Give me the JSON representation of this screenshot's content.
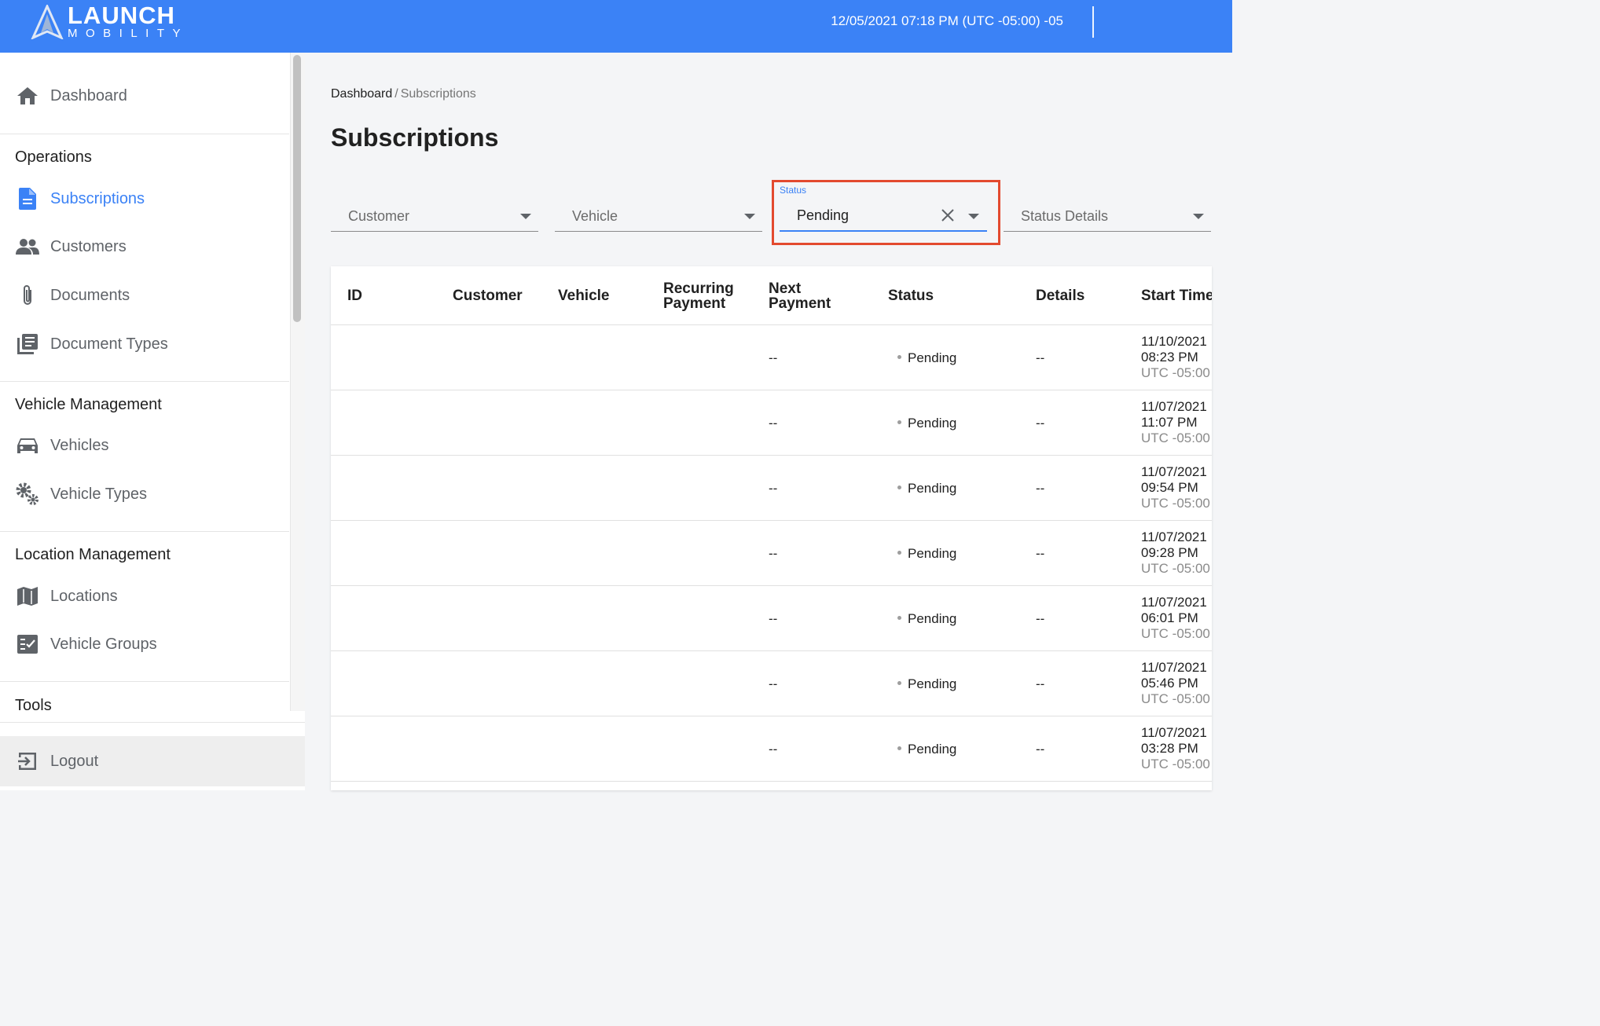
{
  "header": {
    "logo_word": "LAUNCH",
    "logo_sub": "MOBILITY",
    "datetime": "12/05/2021 07:18 PM (UTC -05:00) -05",
    "bg_color": "#3b82f6"
  },
  "sidebar": {
    "dashboard": {
      "label": "Dashboard",
      "icon": "home-icon"
    },
    "sections": {
      "operations": "Operations",
      "vehicle_management": "Vehicle Management",
      "location_management": "Location Management",
      "tools": "Tools"
    },
    "items": {
      "subscriptions": {
        "label": "Subscriptions",
        "icon": "document-icon",
        "active": true
      },
      "customers": {
        "label": "Customers",
        "icon": "people-icon"
      },
      "documents": {
        "label": "Documents",
        "icon": "paperclip-icon"
      },
      "document_types": {
        "label": "Document Types",
        "icon": "library-books-icon"
      },
      "vehicles": {
        "label": "Vehicles",
        "icon": "car-icon"
      },
      "vehicle_types": {
        "label": "Vehicle Types",
        "icon": "gears-icon"
      },
      "locations": {
        "label": "Locations",
        "icon": "map-icon"
      },
      "vehicle_groups": {
        "label": "Vehicle Groups",
        "icon": "checklist-icon"
      }
    },
    "logout": {
      "label": "Logout",
      "icon": "logout-icon"
    }
  },
  "breadcrumb": {
    "root": "Dashboard",
    "separator": "/",
    "current": "Subscriptions"
  },
  "page_title": "Subscriptions",
  "filters": {
    "customer": "Customer",
    "vehicle": "Vehicle",
    "status": {
      "label": "Status",
      "value": "Pending"
    },
    "status_details": "Status Details"
  },
  "table": {
    "headers": {
      "id": "ID",
      "customer": "Customer",
      "vehicle": "Vehicle",
      "recurring_payment_1": "Recurring",
      "recurring_payment_2": "Payment",
      "next_payment_1": "Next",
      "next_payment_2": "Payment",
      "status": "Status",
      "details": "Details",
      "start_time": "Start Time"
    },
    "rows": [
      {
        "next_payment": "--",
        "status": "Pending",
        "details": "--",
        "start_date": "11/10/2021",
        "start_time": "08:23 PM",
        "tz": "UTC -05:00"
      },
      {
        "next_payment": "--",
        "status": "Pending",
        "details": "--",
        "start_date": "11/07/2021",
        "start_time": "11:07 PM",
        "tz": "UTC -05:00"
      },
      {
        "next_payment": "--",
        "status": "Pending",
        "details": "--",
        "start_date": "11/07/2021",
        "start_time": "09:54 PM",
        "tz": "UTC -05:00"
      },
      {
        "next_payment": "--",
        "status": "Pending",
        "details": "--",
        "start_date": "11/07/2021",
        "start_time": "09:28 PM",
        "tz": "UTC -05:00"
      },
      {
        "next_payment": "--",
        "status": "Pending",
        "details": "--",
        "start_date": "11/07/2021",
        "start_time": "06:01 PM",
        "tz": "UTC -05:00"
      },
      {
        "next_payment": "--",
        "status": "Pending",
        "details": "--",
        "start_date": "11/07/2021",
        "start_time": "05:46 PM",
        "tz": "UTC -05:00"
      },
      {
        "next_payment": "--",
        "status": "Pending",
        "details": "--",
        "start_date": "11/07/2021",
        "start_time": "03:28 PM",
        "tz": "UTC -05:00"
      }
    ]
  },
  "colors": {
    "accent": "#3b82f6",
    "highlight_border": "#e34a2f"
  }
}
